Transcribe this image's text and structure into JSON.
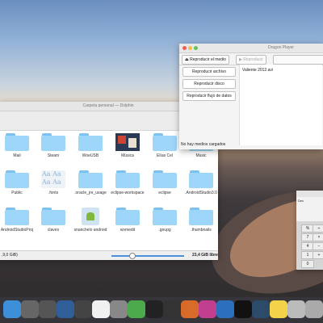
{
  "dolphin": {
    "title": "Carpeta personal — Dolphin",
    "items": [
      {
        "label": "Mail",
        "type": "folder"
      },
      {
        "label": "Steam",
        "type": "folder"
      },
      {
        "label": "WoeUSB",
        "type": "folder"
      },
      {
        "label": "Música",
        "type": "image"
      },
      {
        "label": "Elías Cel",
        "type": "folder"
      },
      {
        "label": "Music",
        "type": "folder"
      },
      {
        "label": "Public",
        "type": "folder"
      },
      {
        "label": ".fonts",
        "type": "fonts"
      },
      {
        "label": ".oracle_jre_usage",
        "type": "folder"
      },
      {
        "label": "eclipse-workspace",
        "type": "folder"
      },
      {
        "label": "eclipse",
        "type": "folder"
      },
      {
        "label": ".AndroidStudio3.0",
        "type": "folder"
      },
      {
        "label": "AndroidStudioProj",
        "type": "folder"
      },
      {
        "label": "claves",
        "type": "folder"
      },
      {
        "label": "snanchelo android",
        "type": "android"
      },
      {
        "label": "wvmedit",
        "type": "folder"
      },
      {
        "label": ".gnupg",
        "type": "folder"
      },
      {
        "label": ".thumbnails",
        "type": "folder"
      }
    ],
    "fonts_glyphs": "Aa Aa\nAa Aa",
    "status_left": ",9,0 GiB)",
    "status_right": "23,4 GiB libre"
  },
  "dragon": {
    "title": "Dragon Player",
    "toolbar": {
      "play_media": "Reproducir el medio",
      "play": "Reproducir"
    },
    "buttons": [
      "Reproducir archivo",
      "Reproducir disco",
      "Reproducir flujo de datos"
    ],
    "list": [
      "Valiente 2012.avi"
    ],
    "status": "No hay medios cargados"
  },
  "calculator": {
    "display_label": "Dec",
    "keys": [
      "%",
      "÷",
      "7",
      "×",
      "4",
      "−",
      "1",
      "+",
      "0"
    ]
  },
  "dock": {
    "apps": [
      "finder",
      "launchpad",
      "system-preferences",
      "image-capture",
      "calculator",
      "photos",
      "trash-hidden",
      "numbers",
      "media-player",
      "clock",
      "text-editor",
      "krita",
      "inkscape",
      "terminal",
      "monitor",
      "notes",
      "file-manager",
      "trash"
    ]
  }
}
